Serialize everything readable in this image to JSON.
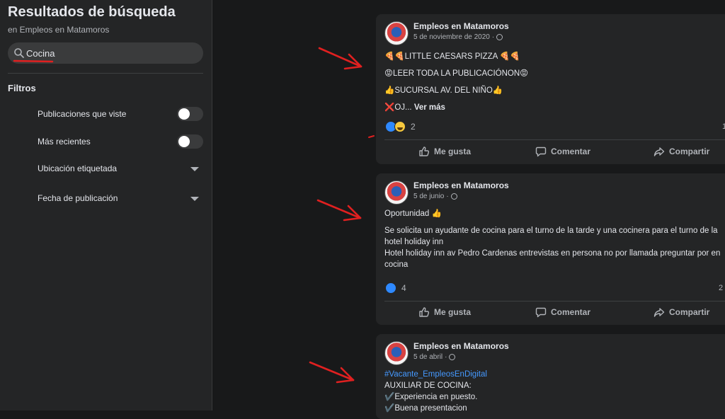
{
  "sidebar": {
    "title": "Resultados de búsqueda",
    "subtitle": "en Empleos en Matamoros",
    "search": {
      "value": "Cocina",
      "placeholder": ""
    },
    "filters_heading": "Filtros",
    "filters": [
      {
        "label": "Publicaciones que viste",
        "kind": "toggle",
        "on": false
      },
      {
        "label": "Más recientes",
        "kind": "toggle",
        "on": false
      },
      {
        "label": "Ubicación etiquetada",
        "kind": "dropdown"
      },
      {
        "label": "Fecha de publicación",
        "kind": "dropdown"
      }
    ]
  },
  "actions": {
    "like": "Me gusta",
    "comment": "Comentar",
    "share": "Compartir"
  },
  "posts": [
    {
      "author": "Empleos en Matamoros",
      "date": "5 de noviembre de 2020",
      "lines": [
        "🍕🍕LITTLE CAESARS PIZZA 🍕🍕",
        "😡LEER TODA LA PUBLICACIÓNON😡",
        "👍SUCURSAL AV. DEL NIÑO👍",
        " ❌OJ..."
      ],
      "more": "Ver más",
      "reaction_count": "2",
      "side_count": "1"
    },
    {
      "author": "Empleos en Matamoros",
      "date": "5 de junio",
      "lines": [
        "Oportunidad 👍",
        "",
        "Se solicita un ayudante de cocina para el turno de la tarde y una cocinera para el turno de la",
        "hotel holiday inn",
        "Hotel holiday inn av Pedro Cardenas entrevistas en persona no por llamada preguntar por en",
        "cocina"
      ],
      "reaction_count": "4",
      "side_count": "2"
    },
    {
      "author": "Empleos en Matamoros",
      "date": "5 de abril",
      "hashtag": "#Vacante_EmpleosEnDigital",
      "lines": [
        "AUXILIAR DE COCINA:",
        "✔️Experiencia en puesto.",
        "✔️Buena presentacion"
      ]
    }
  ],
  "colors": {
    "background": "#18191a",
    "card": "#242526",
    "accent": "#2e89ff",
    "annotation": "#e02020"
  }
}
